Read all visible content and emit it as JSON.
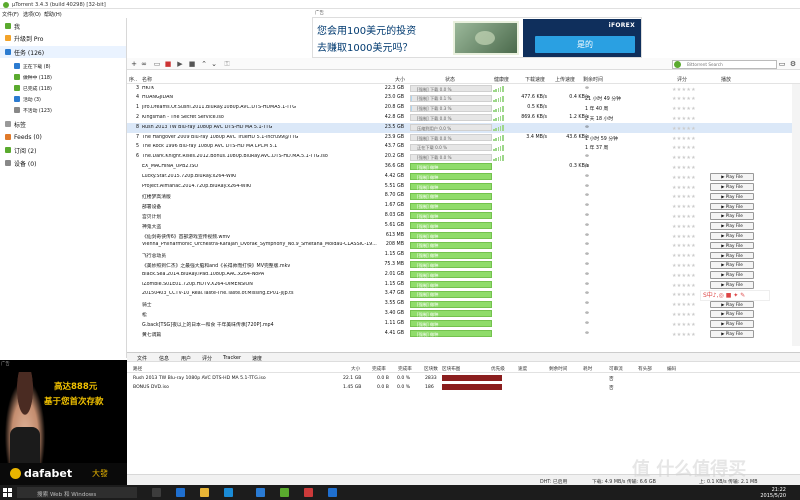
{
  "window": {
    "title": "µTorrent 3.4.3  (build 40298) [32-bit]"
  },
  "menu": [
    "文件(F)",
    "选项(O)",
    "帮助(H)"
  ],
  "sidebar": [
    {
      "label": "我",
      "kind": "big",
      "color": "#5aaa2e",
      "icon": "user-icon"
    },
    {
      "label": "升级到 Pro",
      "kind": "big",
      "color": "#f3a329",
      "icon": "upgrade-icon"
    },
    {
      "label": "任务 (126)",
      "kind": "big",
      "color": "#2b7bd0",
      "icon": "tasks-icon",
      "selected": true
    },
    {
      "label": "正在下载 (8)",
      "kind": "small",
      "color": "#2b7bd0",
      "icon": "download-arrow-icon"
    },
    {
      "label": "做种中 (118)",
      "kind": "small",
      "color": "#5aaa2e",
      "icon": "seed-arrow-icon"
    },
    {
      "label": "已完成 (118)",
      "kind": "small",
      "color": "#5aaa2e",
      "icon": "check-icon"
    },
    {
      "label": "活动 (3)",
      "kind": "small",
      "color": "#2b7bd0",
      "icon": "activity-icon"
    },
    {
      "label": "不活动 (123)",
      "kind": "small",
      "color": "#888888",
      "icon": "inactive-icon"
    },
    {
      "label": "标签",
      "kind": "big",
      "color": "#999999",
      "icon": "tag-icon"
    },
    {
      "label": "Feeds (0)",
      "kind": "big",
      "color": "#e07a2a",
      "icon": "rss-icon"
    },
    {
      "label": "订阅 (2)",
      "kind": "big",
      "color": "#5aaa2e",
      "icon": "subscription-icon"
    },
    {
      "label": "设备 (0)",
      "kind": "big",
      "color": "#888888",
      "icon": "device-icon"
    }
  ],
  "ad_top": {
    "label": "广告",
    "line1": "您会用100美元的投资",
    "line2": "去赚取1000美元吗？",
    "brand": "iFOREX",
    "button": "是的"
  },
  "search": {
    "placeholder": "Bittorrent Search"
  },
  "columns": {
    "num": "序..",
    "name": "名称",
    "size": "大小",
    "status": "状态",
    "health": "健康度",
    "dl": "下载速度",
    "ul": "上传速度",
    "eta": "剩余时间",
    "rating": "评分",
    "play": "播放"
  },
  "torrents": [
    {
      "num": "3",
      "name": "HKTK",
      "size": "22.3 GB",
      "status": "[强制] 下载 0.0 %",
      "pct": 0,
      "done": false,
      "dl": "",
      "ul": "",
      "eta": "∞",
      "play": false
    },
    {
      "num": "4",
      "name": "HUANGJIDAN",
      "size": "23.0 GB",
      "status": "[强制] 下载 0.1 %",
      "pct": 0.1,
      "done": false,
      "dl": "477.6 KB/s",
      "ul": "0.4 KB/s",
      "eta": "21 小时 49 分钟",
      "play": false
    },
    {
      "num": "1",
      "name": "Jiro.Dreams.Of.Sushi.2011.BluRay.1080p.AVC.DTS-HDMA5.1-TTG",
      "size": "20.8 GB",
      "status": "[强制] 下载 0.3 %",
      "pct": 0.3,
      "done": false,
      "dl": "0.5 KB/s",
      "ul": "",
      "eta": "1 年 40 周",
      "play": false
    },
    {
      "num": "2",
      "name": "Kingsman - The Secret Service.iso",
      "size": "42.8 GB",
      "status": "[强制] 下载 0.0 %",
      "pct": 0,
      "done": false,
      "dl": "869.6 KB/s",
      "ul": "1.2 KB/s",
      "eta": "2 天 18 小时",
      "play": false
    },
    {
      "num": "8",
      "name": "Rush 2013 TW Blu-ray 1080p AVC DTS-HD MA 5.1-TTG",
      "size": "23.5 GB",
      "status": "压缩到用户 0.0 %",
      "pct": 0,
      "done": false,
      "dl": "",
      "ul": "",
      "eta": "∞",
      "play": false,
      "selected": true
    },
    {
      "num": "7",
      "name": "The Hangover 2009 Blu-ray 1080p AVC TrueHD 5.1-lhcru99@TTG",
      "size": "23.9 GB",
      "status": "[强制] 下载 0.0 %",
      "pct": 0,
      "done": false,
      "dl": "3.4 MB/s",
      "ul": "43.6 KB/s",
      "eta": "1 小时 59 分钟",
      "play": false
    },
    {
      "num": "5",
      "name": "The Rock 1996 Blu-ray 1080p AVC DTS-HD MA LPCM 5.1",
      "size": "43.7 GB",
      "status": "正在下载 0.0 %",
      "pct": 0,
      "done": false,
      "dl": "",
      "ul": "",
      "eta": "1 年 37 周",
      "play": false
    },
    {
      "num": "6",
      "name": "The.Dark.Knight.Rises.2012.Bonus.1080p.BluRay.AVC.DTS-HD.MA.5.1-TTG.iso",
      "size": "20.2 GB",
      "status": "[强制] 下载 0.0 %",
      "pct": 0,
      "done": false,
      "dl": "",
      "ul": "",
      "eta": "∞",
      "play": false
    },
    {
      "num": "",
      "name": "EX_MACHINA_UPB2.ISO",
      "size": "36.6 GB",
      "status": "[强制] 做种",
      "pct": 100,
      "done": true,
      "dl": "",
      "ul": "0.3 KB/s",
      "eta": "∞",
      "play": false
    },
    {
      "num": "",
      "name": "Lucky.Star.2015.720p.BluRay.x264-WiKi",
      "size": "4.42 GB",
      "status": "[强制] 做种",
      "pct": 100,
      "done": true,
      "dl": "",
      "ul": "",
      "eta": "∞",
      "play": true
    },
    {
      "num": "",
      "name": "Project.Almanac.2014.720p.BluRay.x264-WiKi",
      "size": "5.51 GB",
      "status": "[强制] 做种",
      "pct": 100,
      "done": true,
      "dl": "",
      "ul": "",
      "eta": "∞",
      "play": true
    },
    {
      "num": "",
      "name": "红楼梦高清版",
      "size": "8.70 GB",
      "status": "[强制] 做种",
      "pct": 100,
      "done": true,
      "dl": "",
      "ul": "",
      "eta": "∞",
      "play": true
    },
    {
      "num": "",
      "name": "部署设备",
      "size": "1.67 GB",
      "status": "[强制] 做种",
      "pct": 100,
      "done": true,
      "dl": "",
      "ul": "",
      "eta": "∞",
      "play": true
    },
    {
      "num": "",
      "name": "宫贝计划",
      "size": "8.03 GB",
      "status": "[强制] 做种",
      "pct": 100,
      "done": true,
      "dl": "",
      "ul": "",
      "eta": "∞",
      "play": true
    },
    {
      "num": "",
      "name": "神鬼大盗",
      "size": "5.61 GB",
      "status": "[强制] 做种",
      "pct": 100,
      "done": true,
      "dl": "",
      "ul": "",
      "eta": "∞",
      "play": true
    },
    {
      "num": "",
      "name": "《仙剑奇侠传6》首部游戏宣传视频.wmv",
      "size": "613 MB",
      "status": "[强制] 做种",
      "pct": 100,
      "done": true,
      "dl": "",
      "ul": "",
      "eta": "∞",
      "play": true
    },
    {
      "num": "",
      "name": "Vienna_Philharmonic_Orchestra-Karajan_Dvorak_Symphony_No.9_Smetana_Moldau-CLASSIC-19...",
      "size": "208 MB",
      "status": "[强制] 做种",
      "pct": 100,
      "done": true,
      "dl": "",
      "ul": "",
      "eta": "∞",
      "play": true
    },
    {
      "num": "",
      "name": "飞行总动员",
      "size": "1.15 GB",
      "status": "[强制] 做种",
      "pct": 100,
      "done": true,
      "dl": "",
      "ul": "",
      "eta": "∞",
      "play": true
    },
    {
      "num": "",
      "name": "《美妙照到仁杰》之最强大脑和and《长得帅而打快》MV完整版.mkv",
      "size": "75.3 MB",
      "status": "[强制] 做种",
      "pct": 100,
      "done": true,
      "dl": "",
      "ul": "",
      "eta": "∞",
      "play": true
    },
    {
      "num": "",
      "name": "Black.Sea.2014.BluRay.iPad.1080p.AAC.x264-NoPA",
      "size": "2.01 GB",
      "status": "[强制] 做种",
      "pct": 100,
      "done": true,
      "dl": "",
      "ul": "",
      "eta": "∞",
      "play": true
    },
    {
      "num": "",
      "name": "iZombie.S01E01.720p.HDTV.X264-DIMENSION",
      "size": "1.15 GB",
      "status": "[强制] 做种",
      "pct": 100,
      "done": true,
      "dl": "",
      "ul": "",
      "eta": "∞",
      "play": true
    },
    {
      "num": "",
      "name": "20150403_CCTV-10_Real.Taste-The.Taste.of.Missing.EP01-jljp.ts",
      "size": "3.47 GB",
      "status": "[强制] 做种",
      "pct": 100,
      "done": true,
      "dl": "",
      "ul": "",
      "eta": "∞",
      "play": true
    },
    {
      "num": "",
      "name": "骑士",
      "size": "3.55 GB",
      "status": "[强制] 做种",
      "pct": 100,
      "done": true,
      "dl": "",
      "ul": "",
      "eta": "∞",
      "play": true
    },
    {
      "num": "",
      "name": "松",
      "size": "3.40 GB",
      "status": "[强制] 做种",
      "pct": 100,
      "done": true,
      "dl": "",
      "ul": "",
      "eta": "∞",
      "play": true
    },
    {
      "num": "",
      "name": "G.back[TSG]夜以上的日本一和食 千年美味传承[720P].mp4",
      "size": "1.11 GB",
      "status": "[强制] 做种",
      "pct": 100,
      "done": true,
      "dl": "",
      "ul": "",
      "eta": "∞",
      "play": true
    },
    {
      "num": "",
      "name": "黄七调篇",
      "size": "4.41 GB",
      "status": "[强制] 做种",
      "pct": 100,
      "done": true,
      "dl": "",
      "ul": "",
      "eta": "∞",
      "play": true
    }
  ],
  "play_label": "▶ Play File",
  "sogou": "S中♪,◎ ■ ✦ ✎",
  "detail_tabs": [
    "文件",
    "信息",
    "用户",
    "评分",
    "Tracker",
    "速度"
  ],
  "detail_columns": [
    "路径",
    "大小",
    "完成率",
    "完成率",
    "区块数",
    "区块布图",
    "优先级",
    "速度",
    "剩余时间",
    "耗时",
    "可串流",
    "有头部",
    "编码"
  ],
  "detail_files": [
    {
      "path": "Rush 2013 TW Blu-ray 1080p AVC DTS-HD MA 5.1-TTG.iso",
      "size": "22.1 GB",
      "done": "0.0 B",
      "pct": "0.0 %",
      "pieces": "2833",
      "priority": "正常",
      "stream": "否"
    },
    {
      "path": "BONUS DVD.iso",
      "size": "1.45 GB",
      "done": "0.0 B",
      "pct": "0.0 %",
      "pieces": "186",
      "priority": "正常",
      "stream": "否"
    }
  ],
  "ad_left": {
    "label": "广告",
    "line1": "高达888元",
    "line2": "基于您首次存款",
    "brand": "dafabet",
    "brand_cn": "大發"
  },
  "status": {
    "dht": "DHT: 已启用",
    "down": "下载: 4.9 MB/s 传输: 6.6 GB",
    "up": "上: 0.1 KB/s 传输: 2.1 MB"
  },
  "taskbar": {
    "search": "搜索 Web 和 Windows",
    "time": "21:22",
    "date": "2015/5/20"
  },
  "watermark": "值 什么值得买",
  "colors": {
    "accent": "#5aaa2e",
    "seed_bar": "#8fdc6a",
    "selected_row": "#dbe8f8",
    "piece_bar": "#8b1e1e"
  }
}
